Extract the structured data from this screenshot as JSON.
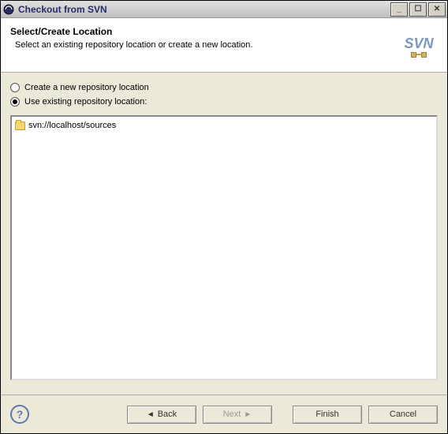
{
  "window": {
    "title": "Checkout from SVN"
  },
  "header": {
    "title": "Select/Create Location",
    "description": "Select an existing repository location or create a new location."
  },
  "logo": {
    "text": "SVN"
  },
  "radios": {
    "create": "Create a new repository location",
    "existing": "Use existing repository location:"
  },
  "repositories": {
    "items": [
      {
        "url": "svn://localhost/sources"
      }
    ]
  },
  "buttons": {
    "back": "Back",
    "next": "Next",
    "finish": "Finish",
    "cancel": "Cancel"
  },
  "help": {
    "symbol": "?"
  }
}
